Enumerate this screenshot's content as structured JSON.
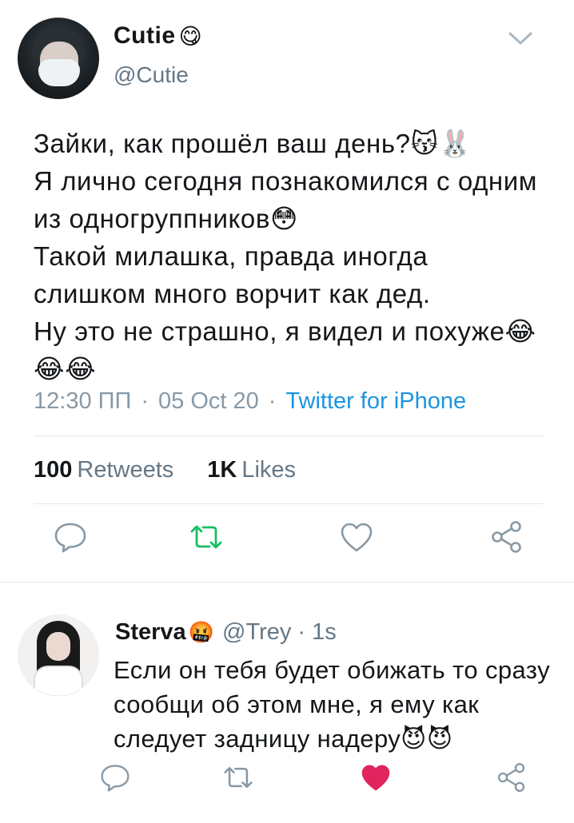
{
  "tweet": {
    "display_name": "Cutie",
    "name_emoji": "😋",
    "handle": "@Cutie",
    "text": "Зайки, как прошёл ваш день?😽🐰\nЯ лично сегодня познакомился с одним из одногруппников😳\nТакой милашка, правда иногда слишком много ворчит как дед.\nНу это не страшно, я видел и похуже😂😂😂",
    "time": "12:30 ПП",
    "date": "05 Oct 20",
    "source": "Twitter for iPhone",
    "retweets_count": "100",
    "retweets_label": "Retweets",
    "likes_count": "1K",
    "likes_label": "Likes",
    "icons": [
      "chevron-down-icon",
      "reply-icon",
      "retweet-icon",
      "like-icon",
      "share-icon"
    ],
    "retweet_color": "#17bf63"
  },
  "reply": {
    "display_name": "Sterva",
    "name_emoji": "🤬",
    "handle": "@Trey",
    "time": "1s",
    "text": "Если он тебя будет обижать то сразу сообщи об этом мне, я ему как следует задницу надеру😈😈",
    "icons": [
      "reply-icon",
      "retweet-icon",
      "like-icon-filled",
      "share-icon"
    ],
    "like_color": "#e0245e"
  },
  "colors": {
    "text": "#14171a",
    "secondary": "#657786",
    "link": "#1b95e0",
    "divider": "#e1e8ed"
  }
}
